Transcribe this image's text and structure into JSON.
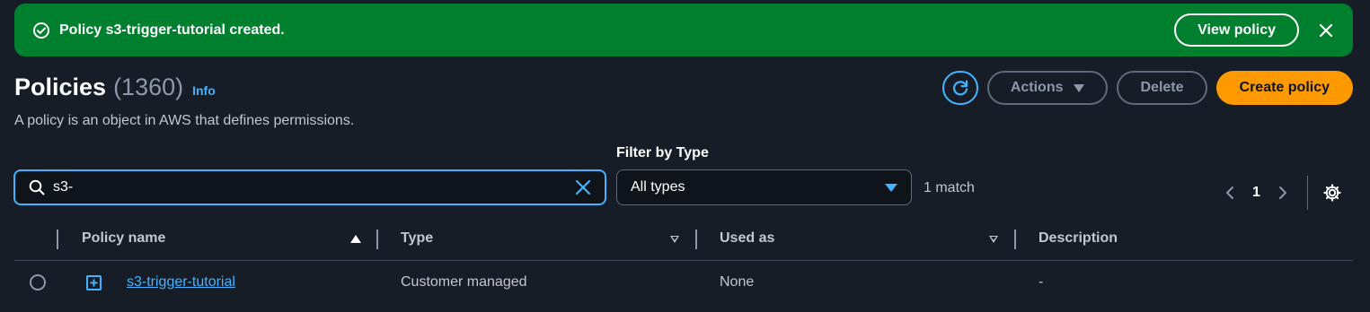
{
  "flash": {
    "message": "Policy s3-trigger-tutorial created.",
    "action_label": "View policy",
    "icons": {
      "status": "check-circle-icon",
      "close": "close-icon"
    }
  },
  "header": {
    "title": "Policies",
    "count": "(1360)",
    "info_label": "Info",
    "description": "A policy is an object in AWS that defines permissions.",
    "buttons": {
      "refresh_icon": "refresh-icon",
      "actions": "Actions",
      "delete": "Delete",
      "create": "Create policy"
    }
  },
  "filter": {
    "search_value": "s3-",
    "type_label": "Filter by Type",
    "type_value": "All types",
    "match_text": "1 match"
  },
  "pagination": {
    "current_page": "1"
  },
  "table": {
    "columns": [
      "Policy name",
      "Type",
      "Used as",
      "Description"
    ],
    "rows": [
      {
        "name": "s3-trigger-tutorial",
        "type": "Customer managed",
        "used_as": "None",
        "description": "-"
      }
    ]
  },
  "colors": {
    "background": "#161d26",
    "success": "#00802f",
    "accent": "#42b4ff",
    "primary_button": "#ff9900"
  }
}
